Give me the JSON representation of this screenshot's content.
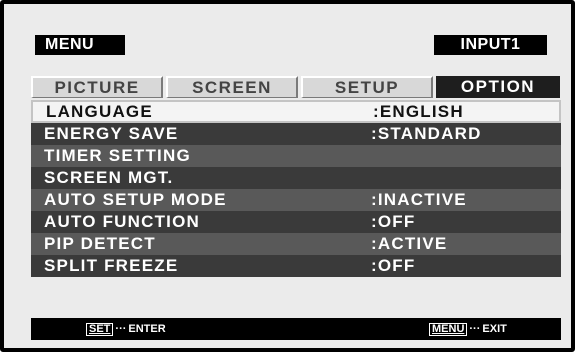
{
  "header": {
    "menu_label": "MENU",
    "input_label": "INPUT1"
  },
  "tabs": [
    {
      "label": "PICTURE"
    },
    {
      "label": "SCREEN"
    },
    {
      "label": "SETUP"
    },
    {
      "label": "OPTION"
    }
  ],
  "rows": [
    {
      "label": "LANGUAGE",
      "value": ":ENGLISH"
    },
    {
      "label": "ENERGY SAVE",
      "value": ":STANDARD"
    },
    {
      "label": "TIMER SETTING",
      "value": ""
    },
    {
      "label": "SCREEN MGT.",
      "value": ""
    },
    {
      "label": "AUTO SETUP MODE",
      "value": ":INACTIVE"
    },
    {
      "label": "AUTO FUNCTION",
      "value": ":OFF"
    },
    {
      "label": "PIP DETECT",
      "value": ":ACTIVE"
    },
    {
      "label": "SPLIT FREEZE",
      "value": ":OFF"
    }
  ],
  "footer": {
    "enter_key": "SET",
    "enter_sep": "···",
    "enter_label": "ENTER",
    "exit_key": "MENU",
    "exit_sep": "···",
    "exit_label": "EXIT"
  }
}
